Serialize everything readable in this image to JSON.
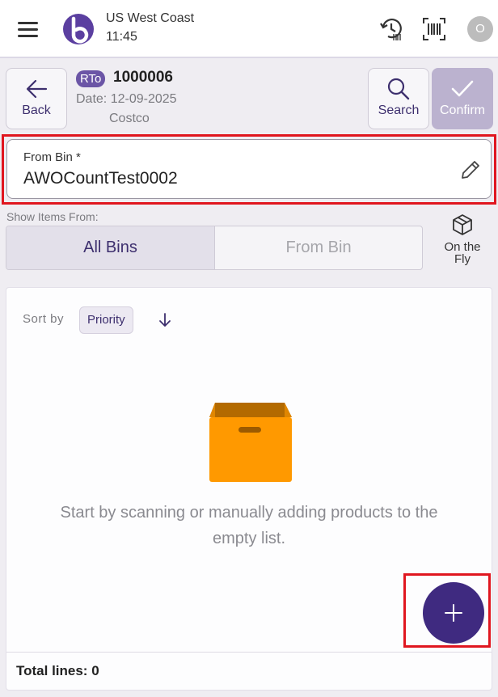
{
  "header": {
    "site_name": "US West Coast",
    "time": "11:45",
    "avatar_initial": "O",
    "brand_color": "#3f2a80"
  },
  "document": {
    "badge": "RTo",
    "number": "1000006",
    "date": "Date: 12-09-2025",
    "customer": "Costco"
  },
  "actions": {
    "back_label": "Back",
    "search_label": "Search",
    "confirm_label": "Confirm"
  },
  "from_bin": {
    "label": "From Bin *",
    "value": "AWOCountTest0002"
  },
  "show_items": {
    "label": "Show Items From:",
    "options": [
      "All Bins",
      "From Bin"
    ],
    "selected": "All Bins",
    "on_the_fly_line1": "On the",
    "on_the_fly_line2": "Fly"
  },
  "list": {
    "sort_label": "Sort by",
    "sort_value": "Priority",
    "empty_message_line1": "Start by scanning or manually adding products to the",
    "empty_message_line2": "empty list.",
    "total_lines": "Total lines: 0"
  },
  "highlight_color": "#e0161f"
}
